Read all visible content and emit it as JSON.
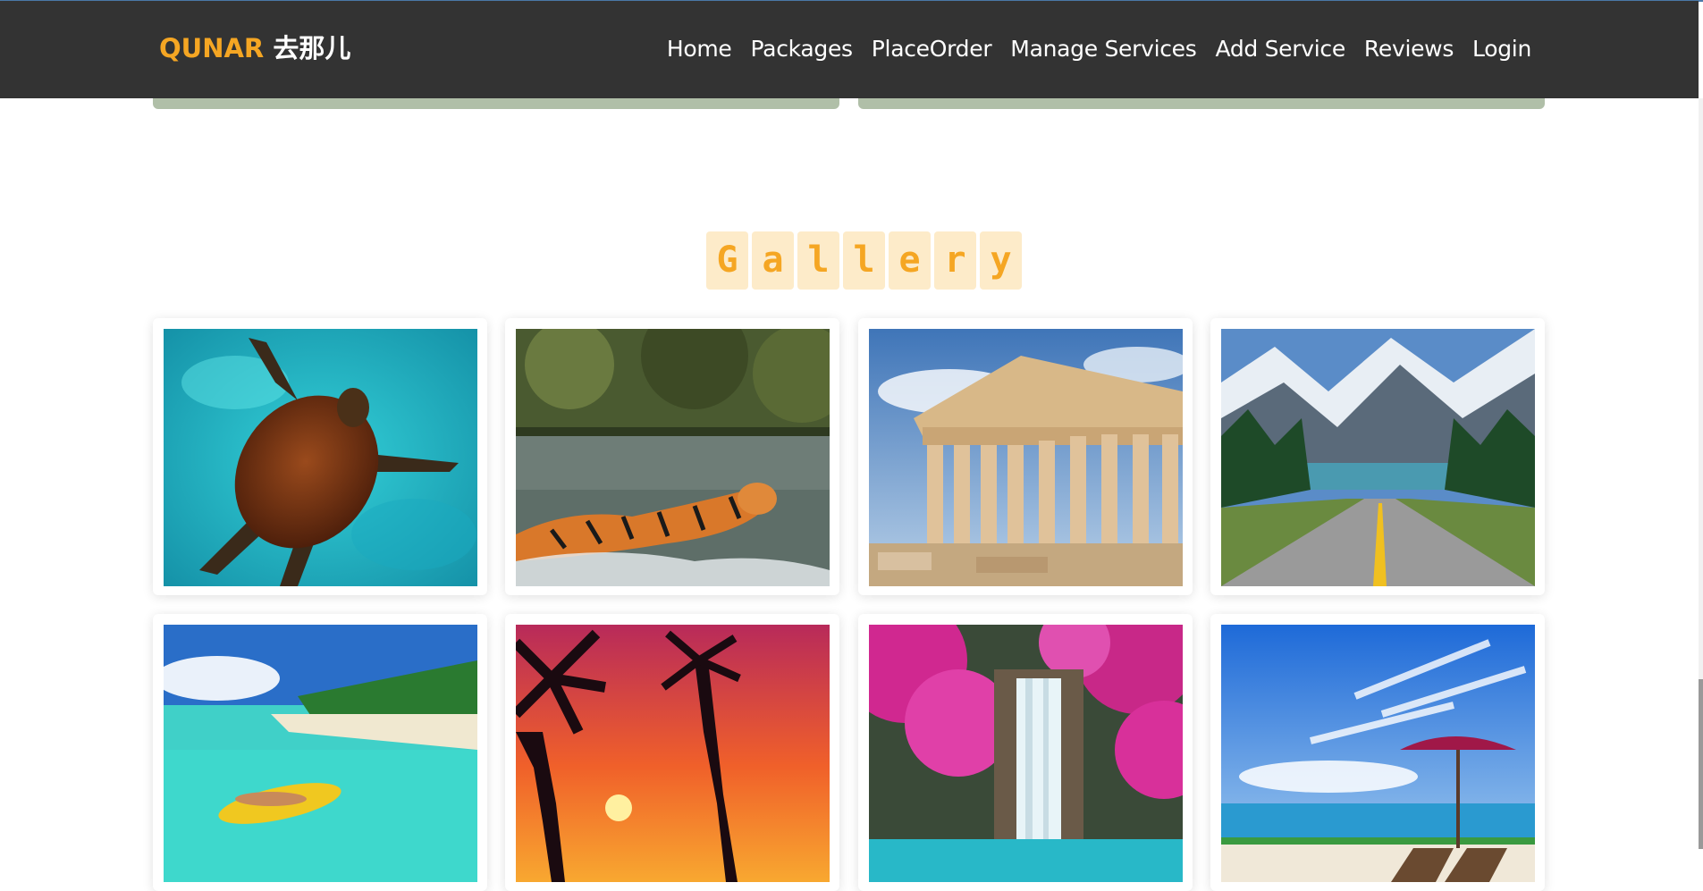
{
  "brand": {
    "part1": "QUNAR",
    "part2": "去那儿"
  },
  "nav": {
    "items": [
      "Home",
      "Packages",
      "PlaceOrder",
      "Manage Services",
      "Add Service",
      "Reviews",
      "Login"
    ]
  },
  "gallery": {
    "letters": [
      "G",
      "a",
      "l",
      "l",
      "e",
      "r",
      "y"
    ],
    "images": [
      "sea-turtle-photo",
      "tiger-photo",
      "parthenon-photo",
      "mountain-road-photo",
      "tropical-beach-photo",
      "palm-sunset-photo",
      "waterfall-photo",
      "beach-umbrella-photo"
    ]
  },
  "colors": {
    "accent": "#f5a623",
    "navbar": "#333333",
    "title_bg": "#fdebc9"
  }
}
